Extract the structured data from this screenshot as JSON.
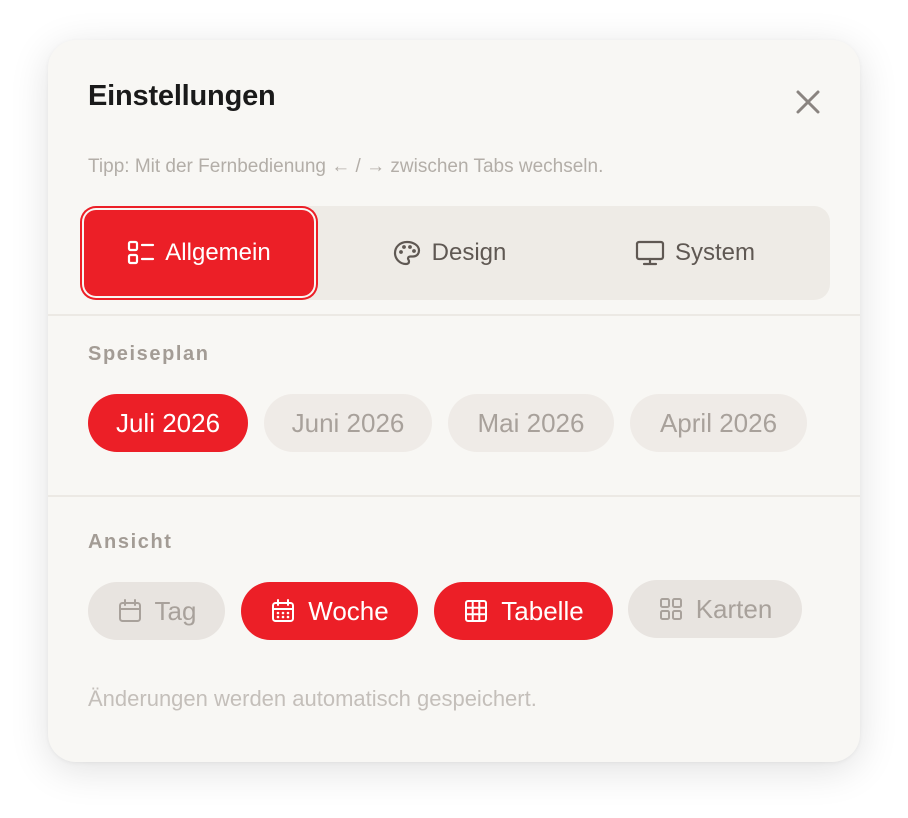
{
  "dialog": {
    "title": "Einstellungen",
    "hint": "Tipp: Mit der Fernbedienung ← / → zwischen Tabs wechseln.",
    "footer": "Änderungen werden automatisch gespeichert."
  },
  "tabs": [
    {
      "label": "Allgemein",
      "icon": "list-layout-icon",
      "active": true
    },
    {
      "label": "Design",
      "icon": "palette-icon",
      "active": false
    },
    {
      "label": "System",
      "icon": "monitor-icon",
      "active": false
    }
  ],
  "speiseplan": {
    "label": "Speiseplan",
    "options": [
      {
        "label": "Juli 2026",
        "selected": true
      },
      {
        "label": "Juni 2026",
        "selected": false
      },
      {
        "label": "Mai 2026",
        "selected": false
      },
      {
        "label": "April 2026",
        "selected": false
      }
    ]
  },
  "ansicht": {
    "label": "Ansicht",
    "options": [
      {
        "label": "Tag",
        "icon": "calendar-icon",
        "selected": false
      },
      {
        "label": "Woche",
        "icon": "calendar-week-icon",
        "selected": true
      },
      {
        "label": "Tabelle",
        "icon": "table-grid-icon",
        "selected": true
      },
      {
        "label": "Karten",
        "icon": "cards-grid-icon",
        "selected": false
      }
    ]
  },
  "colors": {
    "accent": "#ec1f27",
    "panel": "#f8f7f4",
    "tab_track": "#eeebe6",
    "muted_text": "#a8a19b"
  }
}
